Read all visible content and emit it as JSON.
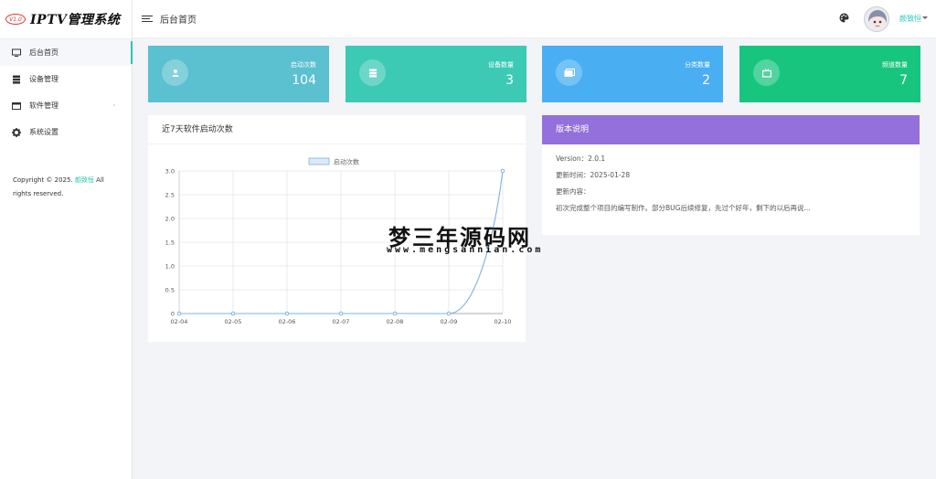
{
  "brand": {
    "badge": "V1.0",
    "title": "IPTV管理系统"
  },
  "sidebar": {
    "items": [
      {
        "label": "后台首页",
        "icon": "monitor-icon",
        "active": true
      },
      {
        "label": "设备管理",
        "icon": "server-icon"
      },
      {
        "label": "软件管理",
        "icon": "window-icon",
        "has_submenu": true
      },
      {
        "label": "系统设置",
        "icon": "gear-icon"
      }
    ],
    "copyright_prefix": "Copyright © 2025.",
    "copyright_name": "颜致恒",
    "copyright_suffix": "All rights reserved."
  },
  "header": {
    "title": "后台首页",
    "username": "颜致恒"
  },
  "stats": [
    {
      "label": "启动次数",
      "value": "104",
      "color": "#5bc0cf",
      "icon": "user-icon"
    },
    {
      "label": "设备数量",
      "value": "3",
      "color": "#3ccab5",
      "icon": "server-icon"
    },
    {
      "label": "分类数量",
      "value": "2",
      "color": "#4aaef2",
      "icon": "folder-icon"
    },
    {
      "label": "频道数量",
      "value": "7",
      "color": "#18c57f",
      "icon": "tv-icon"
    }
  ],
  "chart_panel": {
    "title": "近7天软件启动次数"
  },
  "chart_data": {
    "type": "line",
    "categories": [
      "02-04",
      "02-05",
      "02-06",
      "02-07",
      "02-08",
      "02-09",
      "02-10"
    ],
    "series": [
      {
        "name": "启动次数",
        "values": [
          0,
          0,
          0,
          0,
          0,
          0,
          3
        ]
      }
    ],
    "ylim": [
      0,
      3
    ],
    "yticks": [
      "3.0",
      "2.5",
      "2.0",
      "1.5",
      "1.0",
      "0.5",
      "0"
    ],
    "grid": true,
    "legend": "top-center",
    "line_color": "#7fb3df"
  },
  "version_panel": {
    "title": "版本说明",
    "version": "Version：2.0.1",
    "updated": "更新时间：2025-01-28",
    "content_label": "更新内容：",
    "content": "初次完成整个项目的编写制作。部分BUG后续修复，先过个好年，剩下的以后再说..."
  },
  "watermark": {
    "main": "梦三年源码网",
    "sub": "www.mengsannian.com"
  }
}
